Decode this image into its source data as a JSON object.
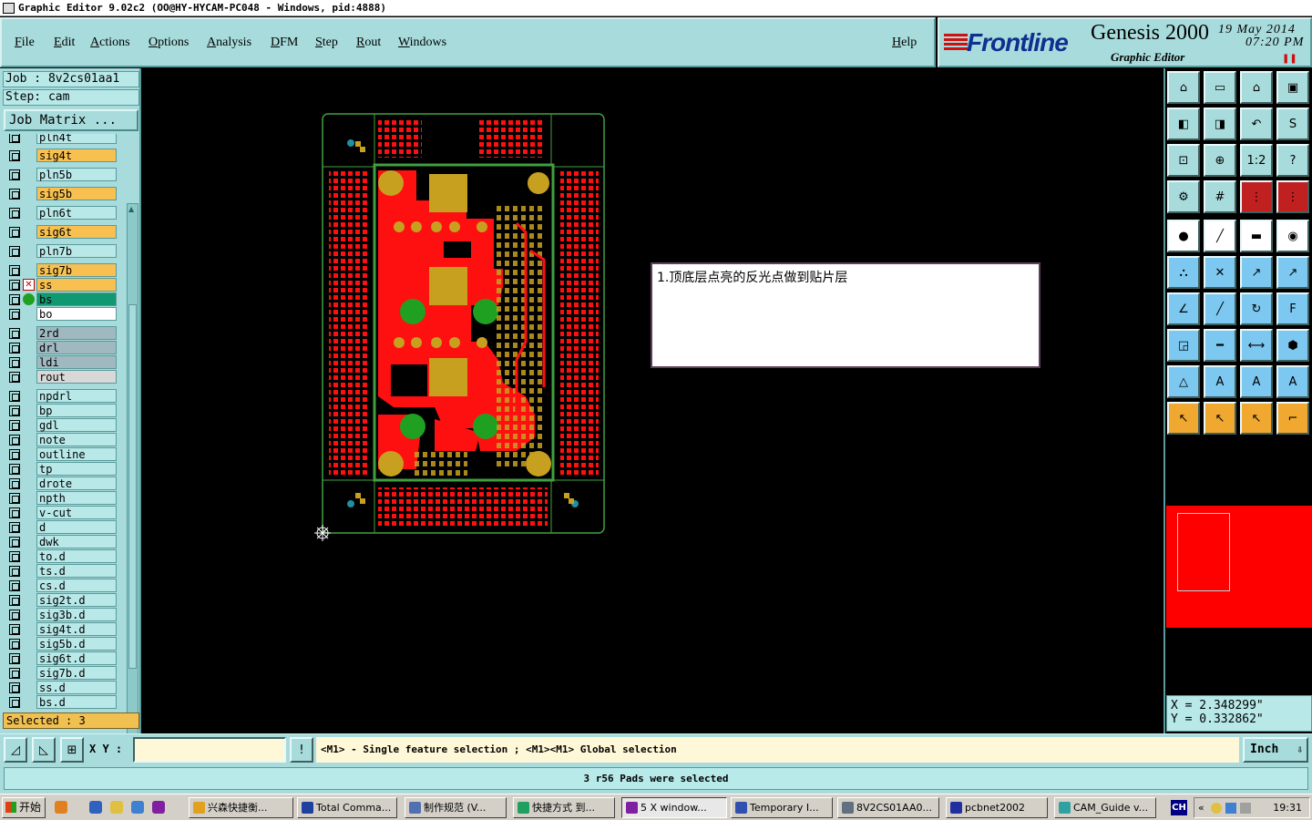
{
  "window": {
    "title": "Graphic Editor 9.02c2 (OO@HY-HYCAM-PC048 - Windows, pid:4888)"
  },
  "menu": {
    "items": [
      "File",
      "Edit",
      "Actions",
      "Options",
      "Analysis",
      "DFM",
      "Step",
      "Rout",
      "Windows"
    ],
    "help": "Help"
  },
  "branding": {
    "logo": "Frontline",
    "product": "Genesis 2000",
    "subtitle": "Graphic Editor",
    "date": "19 May 2014",
    "time": "07:20 PM"
  },
  "job": {
    "job_line": "Job : 8v2cs01aa1",
    "step_line": "Step: cam",
    "matrix_button": "Job Matrix ..."
  },
  "layers": [
    {
      "name": "pln4t",
      "color": "#b8e8e8"
    },
    {
      "name": "sig4t",
      "color": "#f8c050"
    },
    {
      "name": "pln5b",
      "color": "#b8e8e8"
    },
    {
      "name": "sig5b",
      "color": "#f8c050"
    },
    {
      "name": "pln6t",
      "color": "#b8e8e8"
    },
    {
      "name": "sig6t",
      "color": "#f8c050"
    },
    {
      "name": "pln7b",
      "color": "#b8e8e8"
    },
    {
      "name": "sig7b",
      "color": "#f8c050"
    },
    {
      "name": "ss",
      "color": "#f8c050"
    },
    {
      "name": "bs",
      "color": "#109870"
    },
    {
      "name": "bo",
      "color": "#ffffff"
    },
    {
      "name": "2rd",
      "color": "#a0b8c0"
    },
    {
      "name": "drl",
      "color": "#a0b8c0"
    },
    {
      "name": "ldi",
      "color": "#a0b8c0"
    },
    {
      "name": "rout",
      "color": "#d8d8d8"
    },
    {
      "name": "npdrl",
      "color": "#b8e8e8"
    },
    {
      "name": "bp",
      "color": "#b8e8e8"
    },
    {
      "name": "gdl",
      "color": "#b8e8e8"
    },
    {
      "name": "note",
      "color": "#b8e8e8"
    },
    {
      "name": "outline",
      "color": "#b8e8e8"
    },
    {
      "name": "tp",
      "color": "#b8e8e8"
    },
    {
      "name": "drote",
      "color": "#b8e8e8"
    },
    {
      "name": "npth",
      "color": "#b8e8e8"
    },
    {
      "name": "v-cut",
      "color": "#b8e8e8"
    },
    {
      "name": "d",
      "color": "#b8e8e8"
    },
    {
      "name": "dwk",
      "color": "#b8e8e8"
    },
    {
      "name": "to.d",
      "color": "#b8e8e8"
    },
    {
      "name": "ts.d",
      "color": "#b8e8e8"
    },
    {
      "name": "cs.d",
      "color": "#b8e8e8"
    },
    {
      "name": "sig2t.d",
      "color": "#b8e8e8"
    },
    {
      "name": "sig3b.d",
      "color": "#b8e8e8"
    },
    {
      "name": "sig4t.d",
      "color": "#b8e8e8"
    },
    {
      "name": "sig5b.d",
      "color": "#b8e8e8"
    },
    {
      "name": "sig6t.d",
      "color": "#b8e8e8"
    },
    {
      "name": "sig7b.d",
      "color": "#b8e8e8"
    },
    {
      "name": "ss.d",
      "color": "#b8e8e8"
    },
    {
      "name": "bs.d",
      "color": "#b8e8e8"
    }
  ],
  "selection": {
    "label": "Selected : 3"
  },
  "note": {
    "text": "1.顶底层点亮的反光点做到贴片层"
  },
  "coords": {
    "x": "X = 2.348299\"",
    "y": "Y = 0.332862\""
  },
  "command": {
    "xy_label": "X Y :",
    "xy_value": "",
    "prompt": "<M1> - Single feature selection ; <M1><M1> Global selection",
    "units": "Inch"
  },
  "status": {
    "message": "3 r56 Pads were selected"
  },
  "taskbar": {
    "start": "开始",
    "tasks": [
      "兴森快捷衡...",
      "Total Comma...",
      "制作规范 (V...",
      "快捷方式 到...",
      "5 X window...",
      "Temporary I...",
      "8V2CS01AA0...",
      "pcbnet2002",
      "CAM_Guide v..."
    ],
    "lang": "CH",
    "clock": "19:31"
  },
  "colors": {
    "panel": "#a8dcdc",
    "copper": "#ff1010",
    "pad": "#c8a020",
    "outline": "#40a040"
  }
}
